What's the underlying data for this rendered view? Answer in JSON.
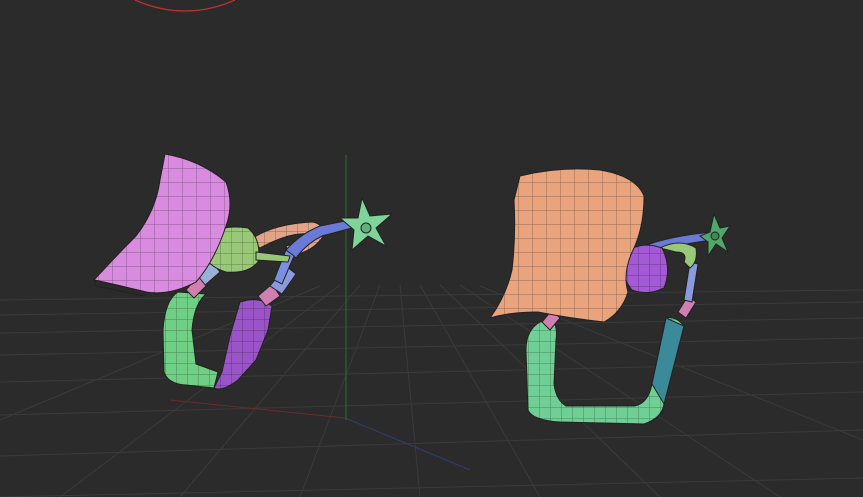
{
  "viewport": {
    "background": "#2b2b2b",
    "grid_color": "#3a3a3a",
    "axis_x_color": "#6a2a2a",
    "axis_y_color": "#2f6b2f",
    "axis_z_color": "#2e3b7a",
    "gizmo_color": "#c03030"
  },
  "objects": [
    {
      "name": "model-left",
      "parts": [
        {
          "part": "cap",
          "color": "#d98be0"
        },
        {
          "part": "hub",
          "color": "#98c878"
        },
        {
          "part": "ring",
          "color": "#e2a488"
        },
        {
          "part": "star",
          "color": "#7fd49a"
        },
        {
          "part": "loop-left",
          "color": "#6fcf84"
        },
        {
          "part": "loop-right",
          "color": "#9a54c8"
        }
      ]
    },
    {
      "name": "model-right",
      "parts": [
        {
          "part": "cap",
          "color": "#e9a47e"
        },
        {
          "part": "hub",
          "color": "#a45ad6"
        },
        {
          "part": "star",
          "color": "#4fa86a"
        },
        {
          "part": "loop",
          "color": "#70cf94"
        }
      ]
    }
  ]
}
